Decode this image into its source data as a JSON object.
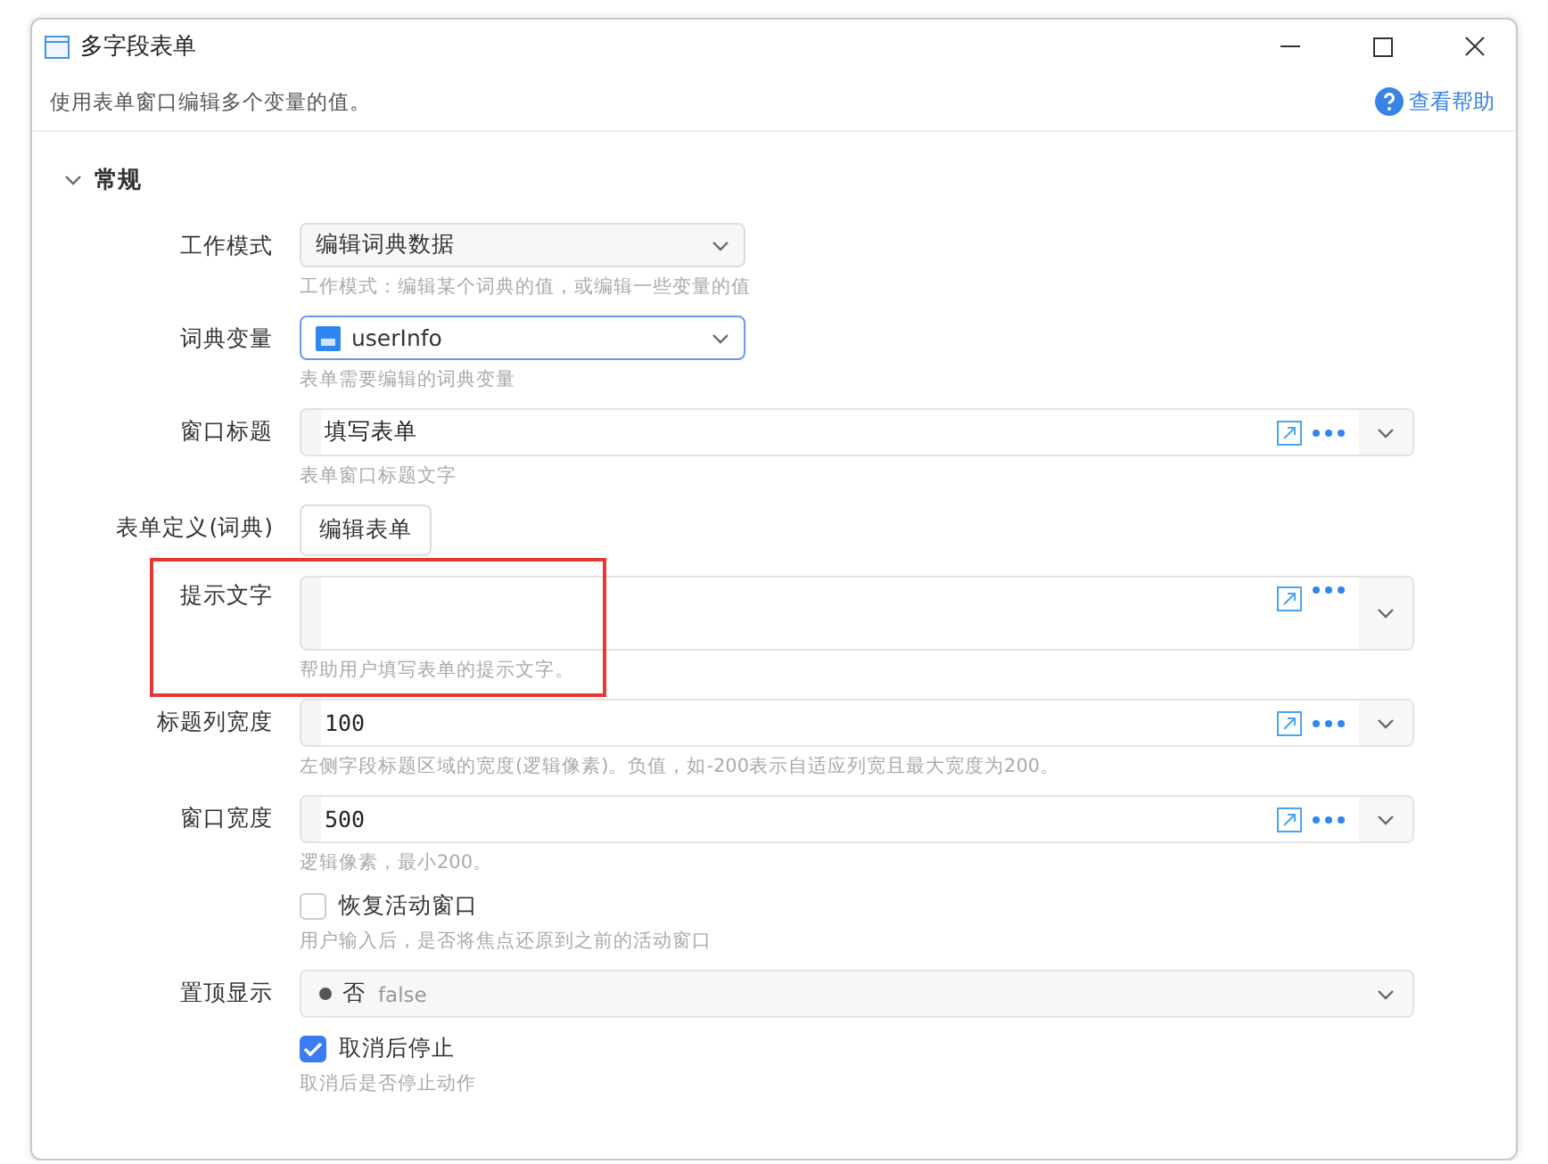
{
  "window": {
    "title": "多字段表单"
  },
  "description": "使用表单窗口编辑多个变量的值。",
  "help_link": "查看帮助",
  "section": {
    "title": "常规",
    "expanded": true,
    "fields": [
      {
        "kind": "select",
        "label": "工作模式",
        "value": "编辑词典数据",
        "hint": "工作模式：编辑某个词典的值，或编辑一些变量的值",
        "focused": false,
        "highlighted": false
      },
      {
        "kind": "variable-select",
        "label": "词典变量",
        "value": "userInfo",
        "hint": "表单需要编辑的词典变量",
        "focused": true,
        "highlighted": false
      },
      {
        "kind": "expression",
        "label": "窗口标题",
        "value": "填写表单",
        "hint": "表单窗口标题文字",
        "highlighted": false
      },
      {
        "kind": "button",
        "label": "表单定义(词典)",
        "button": "编辑表单",
        "highlighted": false
      },
      {
        "kind": "multiline",
        "label": "提示文字",
        "hint": "帮助用户填写表单的提示文字。",
        "highlighted": true
      },
      {
        "kind": "expression",
        "label": "标题列宽度",
        "value": "100",
        "hint": "左侧字段标题区域的宽度(逻辑像素)。负值，如-200表示自适应列宽且最大宽度为200。",
        "highlighted": false
      },
      {
        "kind": "expression",
        "label": "窗口宽度",
        "value": "500",
        "hint": "逻辑像素，最小200。",
        "highlighted": false
      },
      {
        "kind": "checkbox",
        "text": "恢复活动窗口",
        "checked": false,
        "hint": "用户输入后，是否将焦点还原到之前的活动窗口",
        "highlighted": false
      },
      {
        "kind": "boolean-select",
        "label": "置顶显示",
        "value": "否",
        "code": "false",
        "highlighted": false
      },
      {
        "kind": "checkbox",
        "text": "取消后停止",
        "checked": true,
        "hint": "取消后是否停止动作",
        "highlighted": false
      }
    ]
  }
}
